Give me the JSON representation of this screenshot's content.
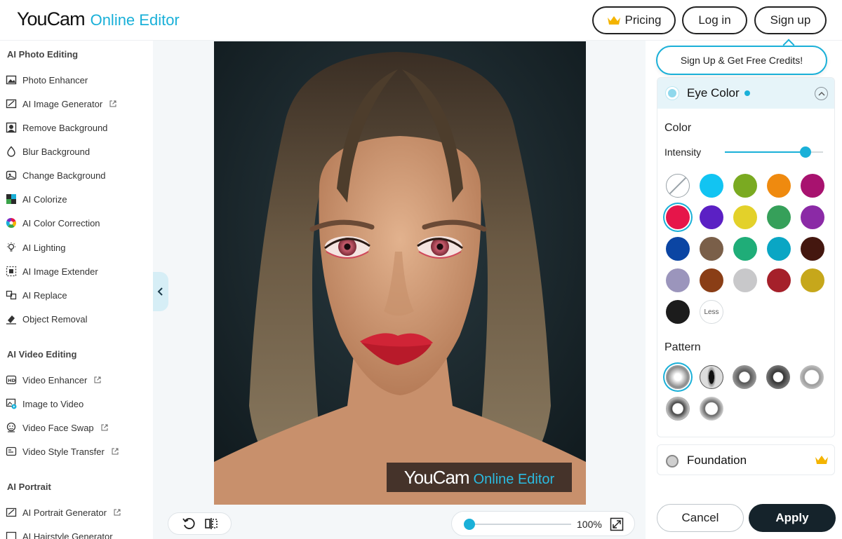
{
  "header": {
    "logo_main": "YouCam",
    "logo_sub": "Online Editor",
    "pricing_label": "Pricing",
    "login_label": "Log in",
    "signup_label": "Sign up"
  },
  "sidebar": {
    "sections": [
      {
        "title": "AI Photo Editing",
        "items": [
          {
            "label": "Photo Enhancer",
            "icon": "photo-enhancer-icon",
            "external": false
          },
          {
            "label": "AI Image Generator",
            "icon": "image-generator-icon",
            "external": true
          },
          {
            "label": "Remove Background",
            "icon": "remove-background-icon",
            "external": false
          },
          {
            "label": "Blur Background",
            "icon": "blur-drop-icon",
            "external": false
          },
          {
            "label": "Change Background",
            "icon": "change-background-icon",
            "external": false
          },
          {
            "label": "AI Colorize",
            "icon": "colorize-icon",
            "external": false
          },
          {
            "label": "AI Color Correction",
            "icon": "color-wheel-icon",
            "external": false
          },
          {
            "label": "AI Lighting",
            "icon": "light-bulb-icon",
            "external": false
          },
          {
            "label": "AI Image Extender",
            "icon": "image-extender-icon",
            "external": false
          },
          {
            "label": "AI Replace",
            "icon": "replace-icon",
            "external": false
          },
          {
            "label": "Object Removal",
            "icon": "eraser-icon",
            "external": false
          }
        ]
      },
      {
        "title": "AI Video Editing",
        "items": [
          {
            "label": "Video Enhancer",
            "icon": "hd-video-icon",
            "external": true
          },
          {
            "label": "Image to Video",
            "icon": "image-to-video-icon",
            "external": false
          },
          {
            "label": "Video Face Swap",
            "icon": "face-swap-icon",
            "external": true
          },
          {
            "label": "Video Style Transfer",
            "icon": "style-transfer-icon",
            "external": true
          }
        ]
      },
      {
        "title": "AI Portrait",
        "items": [
          {
            "label": "AI Portrait Generator",
            "icon": "portrait-generator-icon",
            "external": true
          },
          {
            "label": "AI Hairstyle Generator",
            "icon": "hairstyle-icon",
            "external": true
          }
        ]
      }
    ]
  },
  "canvas": {
    "watermark_main": "YouCam",
    "watermark_sub": "Online Editor",
    "zoom_label": "100%",
    "zoom_level": 0.0
  },
  "panel": {
    "tooltip": "Sign Up & Get Free Credits!",
    "eye_color_title": "Eye Color",
    "color_label": "Color",
    "intensity_label": "Intensity",
    "intensity_value": 0.82,
    "swatches": [
      {
        "type": "none",
        "color": "#ffffff"
      },
      {
        "color": "#12c4f2"
      },
      {
        "color": "#7aaa21"
      },
      {
        "color": "#ef8a0f"
      },
      {
        "color": "#a8126f"
      },
      {
        "color": "#e6154a",
        "selected": true
      },
      {
        "color": "#5b20c4"
      },
      {
        "color": "#e3d12a"
      },
      {
        "color": "#36a05a"
      },
      {
        "color": "#8b2aa6"
      },
      {
        "color": "#0b45a3"
      },
      {
        "color": "#7a5f49"
      },
      {
        "color": "#1fad78"
      },
      {
        "color": "#0aa6c4"
      },
      {
        "color": "#44170f"
      },
      {
        "color": "#9b95bc"
      },
      {
        "color": "#8a3e16"
      },
      {
        "color": "#c8c8ca"
      },
      {
        "color": "#a5202a"
      },
      {
        "color": "#c6a71b"
      },
      {
        "color": "#1c1c1c"
      },
      {
        "type": "less",
        "label": "Less"
      }
    ],
    "pattern_label": "Pattern",
    "patterns_count_visible": 7,
    "foundation_title": "Foundation",
    "cancel_label": "Cancel",
    "apply_label": "Apply",
    "accent": "#1ab0d8"
  }
}
